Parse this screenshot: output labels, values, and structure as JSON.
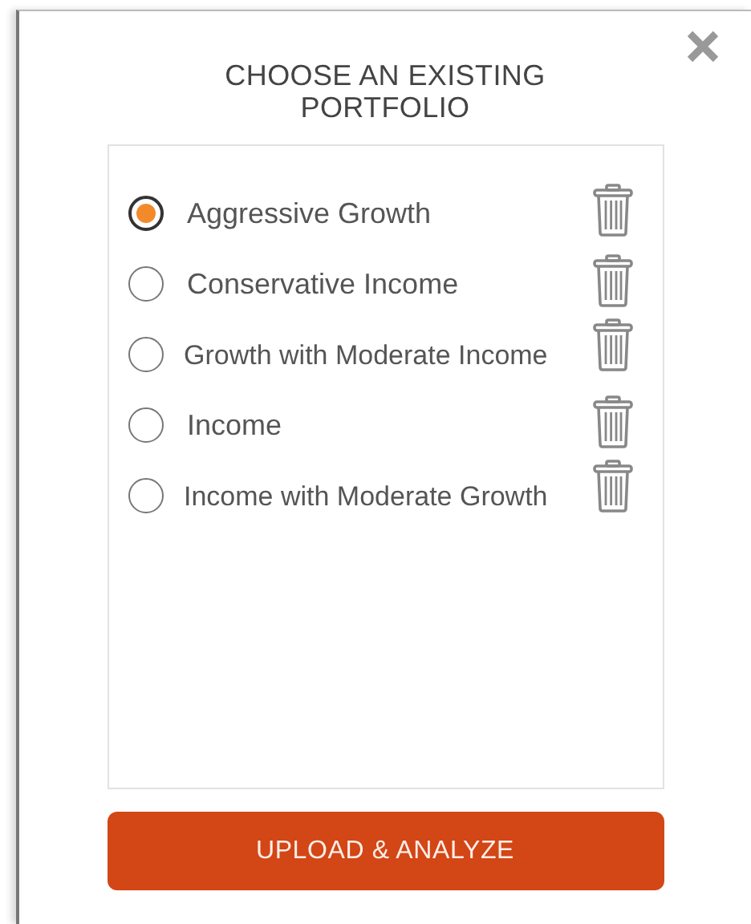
{
  "dialog": {
    "title": "CHOOSE AN EXISTING PORTFOLIO",
    "portfolios": [
      {
        "name": "Aggressive Growth",
        "selected": true
      },
      {
        "name": "Conservative Income",
        "selected": false
      },
      {
        "name": "Growth with Moderate Income",
        "selected": false
      },
      {
        "name": "Income",
        "selected": false
      },
      {
        "name": "Income with Moderate Growth",
        "selected": false
      }
    ],
    "action": "UPLOAD & ANALYZE"
  }
}
